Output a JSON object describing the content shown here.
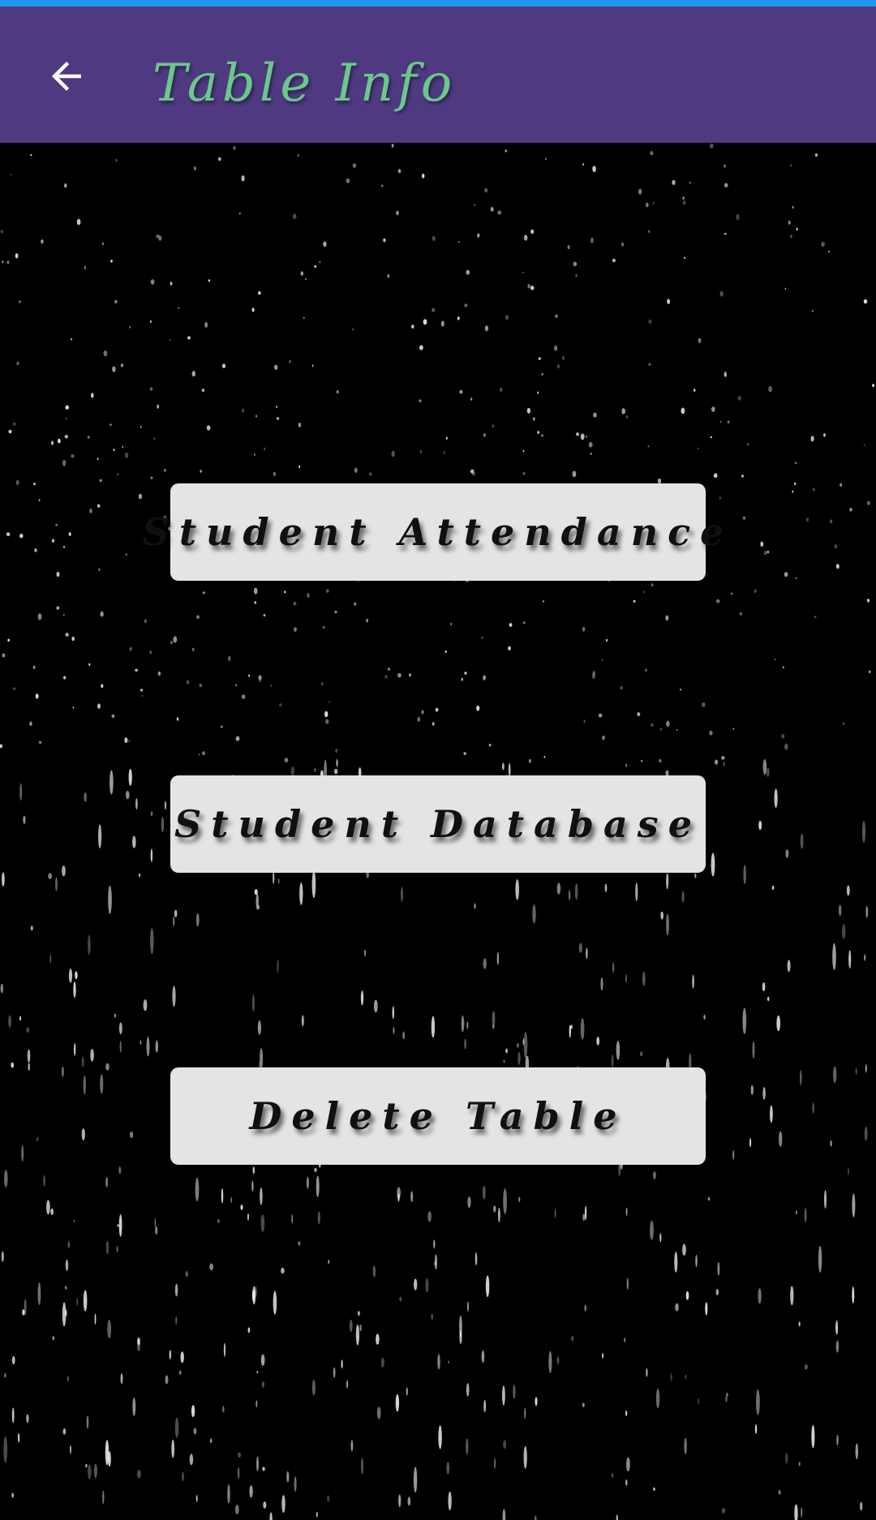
{
  "app_bar": {
    "title": "Table Info",
    "back_icon": "arrow-left-icon",
    "background_color": "#4F3A82",
    "title_color": "#6BC88C"
  },
  "status_strip_color": "#2196F3",
  "background": {
    "style": "starfield",
    "color": "#000000"
  },
  "menu": {
    "student_attendance": "Student Attendance",
    "student_database": "Student Database",
    "delete_table": "Delete Table"
  }
}
